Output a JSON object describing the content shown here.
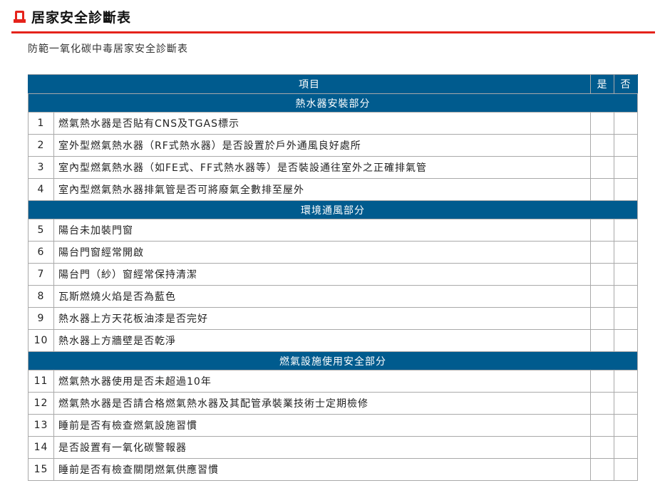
{
  "page": {
    "title": "居家安全診斷表",
    "subtitle": "防範一氧化碳中毒居家安全診斷表"
  },
  "colors": {
    "accent": "#e5231b",
    "table_header": "#005b8e"
  },
  "table": {
    "headers": {
      "item": "項目",
      "yes": "是",
      "no": "否"
    },
    "sections": [
      {
        "title": "熱水器安裝部分",
        "rows": [
          {
            "no": "1",
            "text": "燃氣熱水器是否貼有CNS及TGAS標示"
          },
          {
            "no": "2",
            "text": "室外型燃氣熱水器（RF式熱水器）是否設置於戶外通風良好處所"
          },
          {
            "no": "3",
            "text": "室內型燃氣熱水器（如FE式、FF式熱水器等）是否裝設通往室外之正確排氣管"
          },
          {
            "no": "4",
            "text": "室內型燃氣熱水器排氣管是否可將廢氣全數排至屋外"
          }
        ]
      },
      {
        "title": "環境通風部分",
        "rows": [
          {
            "no": "5",
            "text": "陽台未加裝門窗"
          },
          {
            "no": "6",
            "text": "陽台門窗經常開啟"
          },
          {
            "no": "7",
            "text": "陽台門（紗）窗經常保持清潔"
          },
          {
            "no": "8",
            "text": "瓦斯燃燒火焰是否為藍色"
          },
          {
            "no": "9",
            "text": "熱水器上方天花板油漆是否完好"
          },
          {
            "no": "10",
            "text": "熱水器上方牆壁是否乾淨"
          }
        ]
      },
      {
        "title": "燃氣設施使用安全部分",
        "rows": [
          {
            "no": "11",
            "text": "燃氣熱水器使用是否未超過10年"
          },
          {
            "no": "12",
            "text": "燃氣熱水器是否請合格燃氣熱水器及其配管承裝業技術士定期檢修"
          },
          {
            "no": "13",
            "text": "睡前是否有檢查燃氣設施習慣"
          },
          {
            "no": "14",
            "text": "是否設置有一氧化碳警報器"
          },
          {
            "no": "15",
            "text": "睡前是否有檢查關閉燃氣供應習慣"
          }
        ]
      }
    ]
  }
}
